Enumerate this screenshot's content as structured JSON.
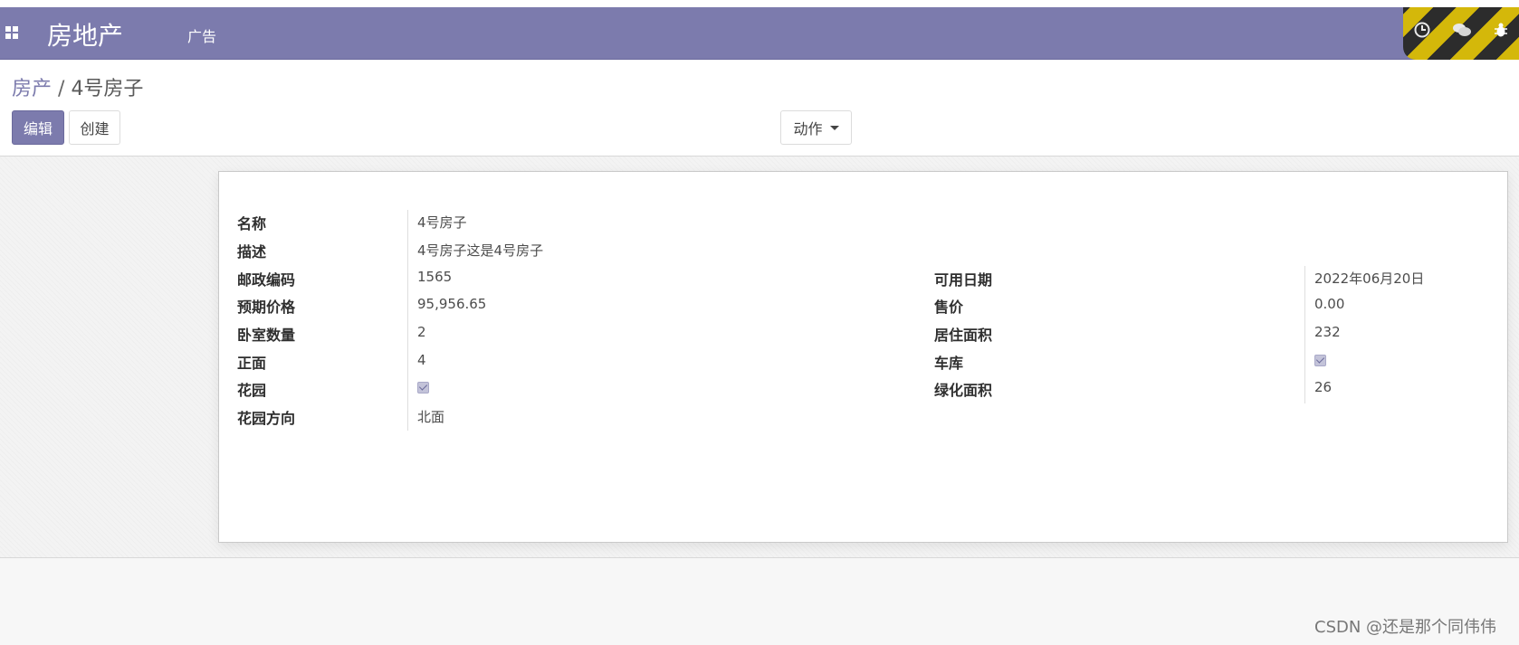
{
  "navbar": {
    "brand": "房地产",
    "menu_item": "广告"
  },
  "breadcrumb": {
    "parent": "房产",
    "separator": "/",
    "current": "4号房子"
  },
  "toolbar": {
    "edit_label": "编辑",
    "create_label": "创建",
    "action_label": "动作"
  },
  "form": {
    "name_label": "名称",
    "name_value": "4号房子",
    "description_label": "描述",
    "description_value": "4号房子这是4号房子",
    "postcode_label": "邮政编码",
    "postcode_value": "1565",
    "expected_price_label": "预期价格",
    "expected_price_value": "95,956.65",
    "bedrooms_label": "卧室数量",
    "bedrooms_value": "2",
    "facades_label": "正面",
    "facades_value": "4",
    "garden_label": "花园",
    "garden_checked": true,
    "garden_orientation_label": "花园方向",
    "garden_orientation_value": "北面",
    "date_available_label": "可用日期",
    "date_available_value": "2022年06月20日",
    "selling_price_label": "售价",
    "selling_price_value": "0.00",
    "living_area_label": "居住面积",
    "living_area_value": "232",
    "garage_label": "车库",
    "garage_checked": true,
    "garden_area_label": "绿化面积",
    "garden_area_value": "26"
  },
  "watermark": "CSDN @还是那个同伟伟",
  "colors": {
    "brand_purple": "#7c7bad",
    "debug_yellow": "#d4b80a",
    "debug_black": "#2c2c2c"
  },
  "icons": [
    "apps-grid-icon",
    "clock-icon",
    "chat-icon",
    "bug-icon",
    "caret-down-icon",
    "checkmark-icon"
  ]
}
